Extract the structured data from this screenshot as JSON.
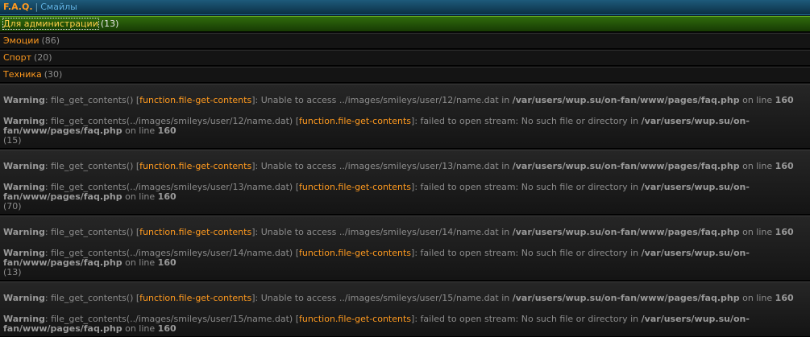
{
  "header": {
    "title": "F.A.Q.",
    "separator": "|",
    "current": "Смайлы"
  },
  "categories": [
    {
      "name": "Для администрации",
      "count": "(13)",
      "active": true
    },
    {
      "name": "Эмоции",
      "count": "(86)",
      "active": false
    },
    {
      "name": "Спорт",
      "count": "(20)",
      "active": false
    },
    {
      "name": "Техника",
      "count": "(30)",
      "active": false
    }
  ],
  "common": {
    "warning": "Warning",
    "fn_call": "file_get_contents()",
    "bracket_open": "[",
    "bracket_close": "]",
    "fn_link": "function.file-get-contents",
    "colon": ":",
    "unable_pre": "Unable to access ",
    "in": "in",
    "file": "/var/users/wup.su/on-fan/www/pages/faq.php",
    "on_line": "on line",
    "line_no": "160",
    "fail_pre": "file_get_contents(",
    "fail_post": ")",
    "fail_msg": "failed to open stream: No such file or directory in"
  },
  "blocks": [
    {
      "path": "../images/smileys/user/12/name.dat",
      "count": "(15)"
    },
    {
      "path": "../images/smileys/user/13/name.dat",
      "count": "(70)"
    },
    {
      "path": "../images/smileys/user/14/name.dat",
      "count": "(13)"
    },
    {
      "path": "../images/smileys/user/15/name.dat",
      "count": ""
    }
  ]
}
